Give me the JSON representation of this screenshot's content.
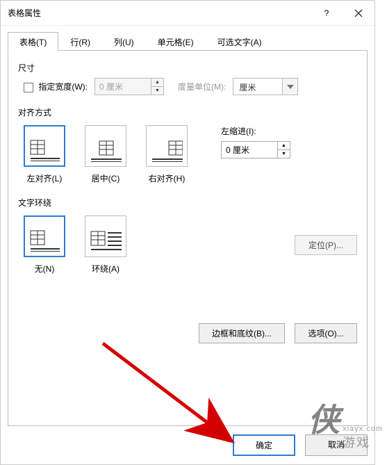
{
  "titlebar": {
    "title": "表格属性",
    "help": "?",
    "close": "✕"
  },
  "tabs": {
    "table": "表格(T)",
    "row": "行(R)",
    "column": "列(U)",
    "cell": "单元格(E)",
    "alttext": "可选文字(A)"
  },
  "size": {
    "label": "尺寸",
    "specify_width_label": "指定宽度(W):",
    "width_value": "0 厘米",
    "unit_label": "度量单位(M):",
    "unit_value": "厘米"
  },
  "align": {
    "label": "对齐方式",
    "left": "左对齐(L)",
    "center": "居中(C)",
    "right": "右对齐(H)",
    "indent_label": "左缩进(I):",
    "indent_value": "0 厘米"
  },
  "wrap": {
    "label": "文字环绕",
    "none": "无(N)",
    "around": "环绕(A)",
    "position_btn": "定位(P)..."
  },
  "buttons": {
    "border_shading": "边框和底纹(B)...",
    "options": "选项(O)...",
    "ok": "确定",
    "cancel": "取消"
  },
  "watermark": {
    "logo": "侠",
    "sub": "xiayx.com",
    "brand": "游戏"
  }
}
